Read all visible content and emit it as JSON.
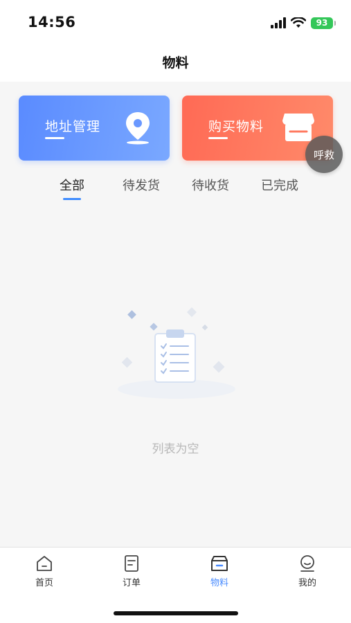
{
  "status_bar": {
    "time": "14:56",
    "battery": "93"
  },
  "header": {
    "title": "物料"
  },
  "cards": {
    "address": {
      "label": "地址管理",
      "color": "#5a8bff"
    },
    "buy": {
      "label": "购买物料",
      "color": "#ff6a55"
    }
  },
  "float_button": {
    "label": "呼救"
  },
  "tabs": [
    {
      "label": "全部",
      "active": true
    },
    {
      "label": "待发货",
      "active": false
    },
    {
      "label": "待收货",
      "active": false
    },
    {
      "label": "已完成",
      "active": false
    }
  ],
  "empty_state": {
    "text": "列表为空",
    "icon": "clipboard-illustration"
  },
  "tab_bar": {
    "items": [
      {
        "label": "首页",
        "icon": "home-icon",
        "active": false
      },
      {
        "label": "订单",
        "icon": "order-icon",
        "active": false
      },
      {
        "label": "物料",
        "icon": "material-icon",
        "active": true
      },
      {
        "label": "我的",
        "icon": "profile-icon",
        "active": false
      }
    ],
    "active_color": "#4a8cff"
  }
}
